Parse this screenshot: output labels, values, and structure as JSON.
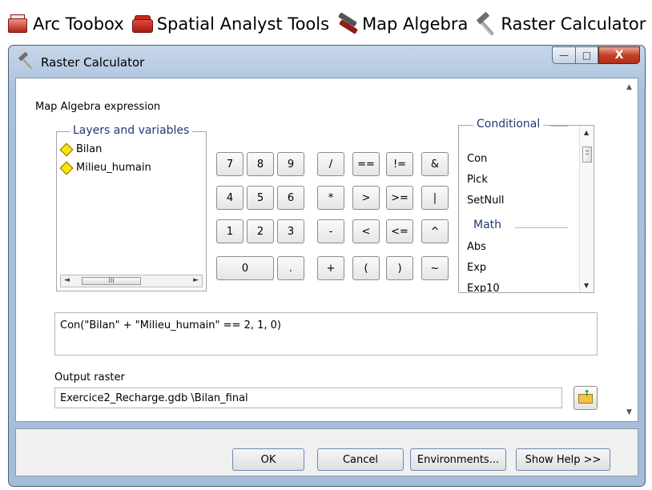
{
  "breadcrumb": {
    "items": [
      {
        "label": "Arc Toobox",
        "icon": "arc-toolbox-icon"
      },
      {
        "label": "Spatial Analyst Tools",
        "icon": "toolbox-icon"
      },
      {
        "label": "Map Algebra",
        "icon": "map-algebra-icon"
      },
      {
        "label": "Raster Calculator",
        "icon": "hammer-icon"
      }
    ]
  },
  "window": {
    "title": "Raster Calculator",
    "controls": {
      "minimize": "—",
      "maximize": "□",
      "close": "X"
    }
  },
  "form": {
    "expression_label": "Map Algebra expression",
    "layers_title": "Layers and variables",
    "layers": [
      "Bilan",
      "Milieu_humain"
    ],
    "scroll_thumb": "III",
    "calculator_keys": [
      "7",
      "8",
      "9",
      "/",
      "==",
      "!=",
      "&",
      "4",
      "5",
      "6",
      "*",
      ">",
      ">=",
      "|",
      "1",
      "2",
      "3",
      "-",
      "<",
      "<=",
      "^",
      "0",
      ".",
      "+",
      "(",
      ")",
      "~"
    ],
    "conditional_title": "Conditional",
    "conditional": [
      "Con",
      "Pick",
      "SetNull"
    ],
    "math_title": "Math",
    "math": [
      "Abs",
      "Exp",
      "Exp10"
    ],
    "expression": "Con(\"Bilan\" + \"Milieu_humain\" == 2, 1, 0)",
    "output_label": "Output raster",
    "output_value": "Exercice2_Recharge.gdb \\Bilan_final"
  },
  "footer": {
    "ok": "OK",
    "cancel": "Cancel",
    "environments": "Environments...",
    "show_help": "Show Help >>"
  }
}
